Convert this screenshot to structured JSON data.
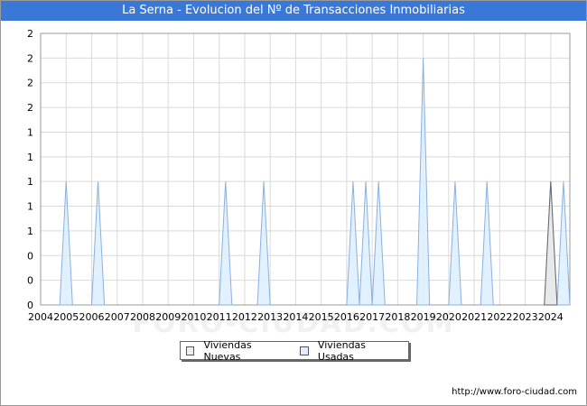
{
  "title": "La Serna - Evolucion del Nº de Transacciones Inmobiliarias",
  "footer": "http://www.foro-ciudad.com",
  "watermark": "FORO-CIUDAD.COM",
  "colors": {
    "title_bg": "#3a78d8",
    "usadas_fill": "#ddeeff",
    "usadas_line": "#8ab0e0",
    "nuevas_fill": "#e8e8e8",
    "nuevas_line": "#666666",
    "grid": "#d9d9d9"
  },
  "chart_data": {
    "type": "area",
    "title": "La Serna - Evolucion del Nº de Transacciones Inmobiliarias",
    "xlabel": "",
    "ylabel": "",
    "xlim": [
      2004,
      2024.75
    ],
    "ylim": [
      0,
      2.2
    ],
    "y_tick_values": [
      0,
      0.2,
      0.4,
      0.6,
      0.8,
      1.0,
      1.2,
      1.4,
      1.6,
      1.8,
      2.0,
      2.2
    ],
    "y_tick_labels": [
      "0",
      "0",
      "0",
      "1",
      "1",
      "1",
      "1",
      "1",
      "2",
      "2",
      "2",
      "2"
    ],
    "x_tick_labels": [
      "2004",
      "2005",
      "2006",
      "2007",
      "2008",
      "2009",
      "2010",
      "2011",
      "2012",
      "2013",
      "2014",
      "2015",
      "2016",
      "2017",
      "2018",
      "2019",
      "2020",
      "2021",
      "2022",
      "2023",
      "2024"
    ],
    "grid": true,
    "legend_position": "bottom-center",
    "series": [
      {
        "name": "Viviendas Nuevas",
        "points": [
          {
            "x": 2024.0,
            "y": 1
          }
        ]
      },
      {
        "name": "Viviendas Usadas",
        "points": [
          {
            "x": 2005.0,
            "y": 1
          },
          {
            "x": 2006.25,
            "y": 1
          },
          {
            "x": 2011.25,
            "y": 1
          },
          {
            "x": 2012.75,
            "y": 1
          },
          {
            "x": 2016.25,
            "y": 1
          },
          {
            "x": 2016.75,
            "y": 1
          },
          {
            "x": 2017.25,
            "y": 1
          },
          {
            "x": 2019.0,
            "y": 2
          },
          {
            "x": 2020.25,
            "y": 1
          },
          {
            "x": 2021.5,
            "y": 1
          },
          {
            "x": 2024.0,
            "y": 1
          },
          {
            "x": 2024.5,
            "y": 1
          }
        ]
      }
    ]
  }
}
